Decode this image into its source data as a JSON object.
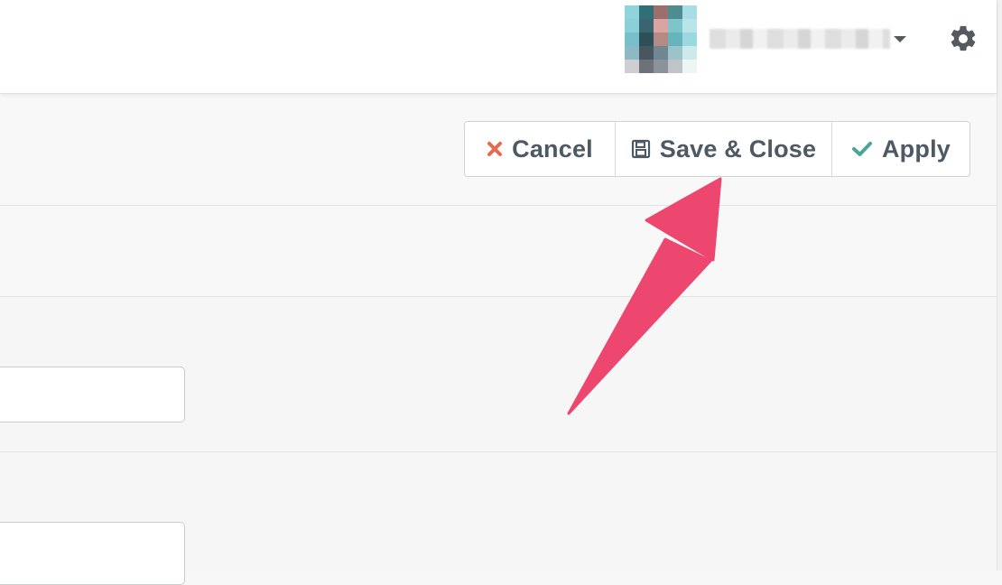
{
  "header": {
    "user_menu": {
      "avatar_icon": "pixelated-avatar-icon",
      "username": "",
      "caret_icon": "caret-down-icon"
    },
    "settings_icon": "gear-icon"
  },
  "toolbar": {
    "buttons": [
      {
        "label": "Cancel",
        "icon": "close-icon",
        "icon_color": "#e56b4e"
      },
      {
        "label": "Save & Close",
        "icon": "floppy-disk-icon",
        "icon_color": "#4d5964"
      },
      {
        "label": "Apply",
        "icon": "check-icon",
        "icon_color": "#4aa796"
      }
    ]
  },
  "form": {
    "field_1_value": "",
    "field_2_value": ""
  },
  "annotation": {
    "arrow_color": "#ed476f",
    "points_to": "Save & Close"
  }
}
